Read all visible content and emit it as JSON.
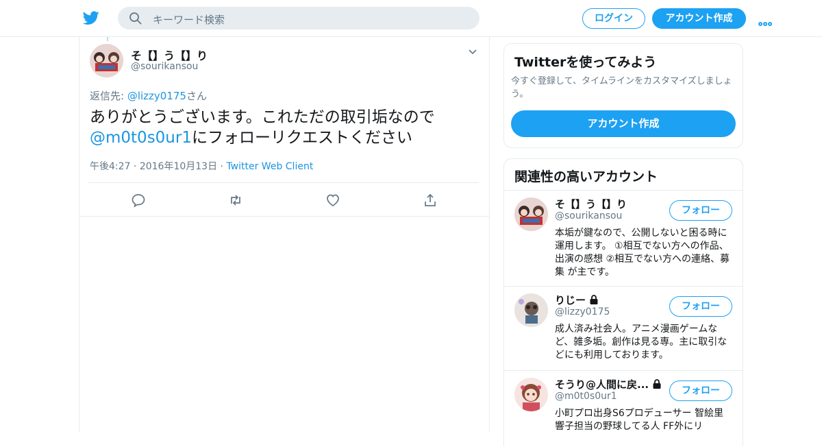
{
  "header": {
    "search_placeholder": "キーワード検索",
    "login_label": "ログイン",
    "signup_label": "アカウント作成",
    "more_icon": "more-dots-icon",
    "logo_icon": "twitter-bird-icon"
  },
  "tweet": {
    "author_name": "そ【】う【】り",
    "author_handle": "@sourikansou",
    "reply_prefix": "返信先: ",
    "reply_mention": "@lizzy0175",
    "reply_suffix": "さん",
    "text_line1": "ありがとうございます。これただの取引垢なので",
    "text_mention": "@m0t0s0ur1",
    "text_line2_rest": "にフォローリクエストください",
    "time": "午後4:27",
    "dot1": " · ",
    "date": "2016年10月13日",
    "dot2": " · ",
    "client": "Twitter Web Client"
  },
  "sidebar": {
    "signup_card": {
      "title": "Twitterを使ってみよう",
      "desc": "今すぐ登録して、タイムラインをカスタマイズしましょう。",
      "button": "アカウント作成"
    },
    "related": {
      "title": "関連性の高いアカウント",
      "accounts": [
        {
          "name": "そ【】う【】り",
          "handle": "@sourikansou",
          "follow": "フォロー",
          "bio": "本垢が鍵なので、公開しないと困る時に運用します。 ①相互でない方への作品、出演の感想 ②相互でない方への連絡、募集 が主です。",
          "locked": false
        },
        {
          "name": "りじー",
          "handle": "@lizzy0175",
          "follow": "フォロー",
          "bio": "成人済み社会人。アニメ漫画ゲームなど、雑多垢。創作は見る専。主に取引などにも利用しております。",
          "locked": true
        },
        {
          "name": "そうり@人間に戻...",
          "handle": "@m0t0s0ur1",
          "follow": "フォロー",
          "bio": "小町プロ出身S6プロデューサー 智絵里 響子担当の野球してる人 FF外にリ",
          "locked": true
        }
      ]
    }
  },
  "colors": {
    "accent": "#1da1f2",
    "link": "#1b95e0",
    "muted": "#657786",
    "border": "#e6ecf0"
  }
}
